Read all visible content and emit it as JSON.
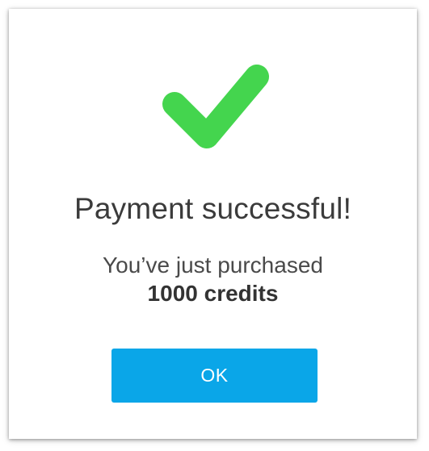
{
  "dialog": {
    "title": "Payment successful!",
    "message_line1": "You’ve just purchased",
    "message_line2": "1000 credits",
    "ok_label": "OK",
    "icon": "checkmark-icon"
  },
  "colors": {
    "check": "#44d54e",
    "button": "#0aa6e8",
    "title_text": "#3b3b3b",
    "body_text": "#4a4a4a"
  }
}
